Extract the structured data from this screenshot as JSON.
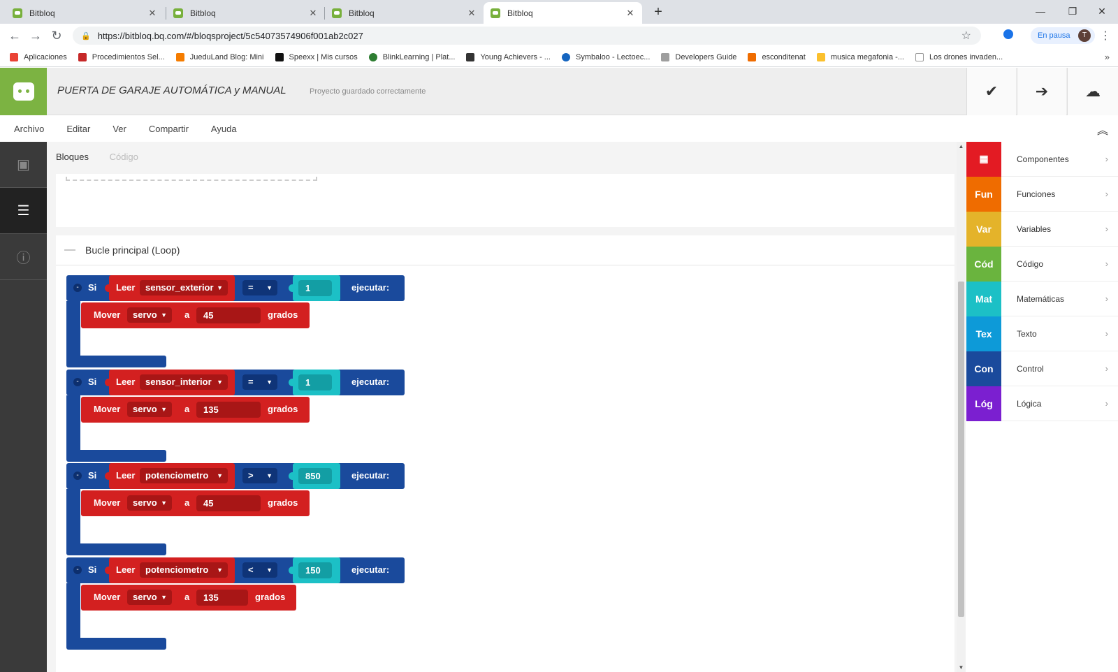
{
  "browser": {
    "tabs": [
      {
        "title": "Bitbloq",
        "active": false
      },
      {
        "title": "Bitbloq",
        "active": false
      },
      {
        "title": "Bitbloq",
        "active": false
      },
      {
        "title": "Bitbloq",
        "active": true
      }
    ],
    "url": "https://bitbloq.bq.com/#/bloqsproject/5c54073574906f001ab2c027",
    "profile_status": "En pausa",
    "profile_initial": "T",
    "bookmarks": [
      {
        "label": "Aplicaciones",
        "color": "#ea4335"
      },
      {
        "label": "Procedimientos Sel...",
        "color": "#c62828"
      },
      {
        "label": "JueduLand Blog: Mini",
        "color": "#f57c00"
      },
      {
        "label": "Speexx | Mis cursos",
        "color": "#111111"
      },
      {
        "label": "BlinkLearning | Plat...",
        "color": "#2e7d32"
      },
      {
        "label": "Young Achievers - ...",
        "color": "#333333"
      },
      {
        "label": "Symbaloo - Lectoec...",
        "color": "#1565c0"
      },
      {
        "label": "Developers Guide",
        "color": "#9e9e9e"
      },
      {
        "label": "esconditenat",
        "color": "#ef6c00"
      },
      {
        "label": "musica megafonia -...",
        "color": "#fbc02d"
      },
      {
        "label": "Los drones invaden...",
        "color": "#bdbdbd"
      }
    ]
  },
  "app": {
    "project_title": "PUERTA DE GARAJE AUTOMÁTICA y MANUAL",
    "save_status": "Proyecto guardado correctamente",
    "menu": [
      "Archivo",
      "Editar",
      "Ver",
      "Compartir",
      "Ayuda"
    ],
    "subtabs": {
      "blocks": "Bloques",
      "code": "Código"
    },
    "loop_title": "Bucle principal (Loop)"
  },
  "bloqs": [
    {
      "si": "Si",
      "leer": "Leer",
      "sensor": "sensor_exterior",
      "op": "=",
      "value": "1",
      "ejecutar": "ejecutar:",
      "mover": "Mover",
      "servo": "servo",
      "a": "a",
      "angle": "45",
      "grados": "grados"
    },
    {
      "si": "Si",
      "leer": "Leer",
      "sensor": "sensor_interior",
      "op": "=",
      "value": "1",
      "ejecutar": "ejecutar:",
      "mover": "Mover",
      "servo": "servo",
      "a": "a",
      "angle": "135",
      "grados": "grados"
    },
    {
      "si": "Si",
      "leer": "Leer",
      "sensor": "potenciometro",
      "op": ">",
      "value": "850",
      "ejecutar": "ejecutar:",
      "mover": "Mover",
      "servo": "servo",
      "a": "a",
      "angle": "45",
      "grados": "grados"
    },
    {
      "si": "Si",
      "leer": "Leer",
      "sensor": "potenciometro",
      "op": "<",
      "value": "150",
      "ejecutar": "ejecutar:",
      "mover": "Mover",
      "servo": "servo",
      "a": "a",
      "angle": "135",
      "grados": "grados"
    }
  ],
  "palette": [
    {
      "short": "",
      "label": "Componentes",
      "color": "#e31b23",
      "icon": "chip-icon"
    },
    {
      "short": "Fun",
      "label": "Funciones",
      "color": "#ef6c00"
    },
    {
      "short": "Var",
      "label": "Variables",
      "color": "#e4b32a"
    },
    {
      "short": "Cód",
      "label": "Código",
      "color": "#6ab43e"
    },
    {
      "short": "Mat",
      "label": "Matemáticas",
      "color": "#1cc0c6"
    },
    {
      "short": "Tex",
      "label": "Texto",
      "color": "#0d9ad8"
    },
    {
      "short": "Con",
      "label": "Control",
      "color": "#1a4a9c"
    },
    {
      "short": "Lóg",
      "label": "Lógica",
      "color": "#7b1fd0"
    }
  ]
}
